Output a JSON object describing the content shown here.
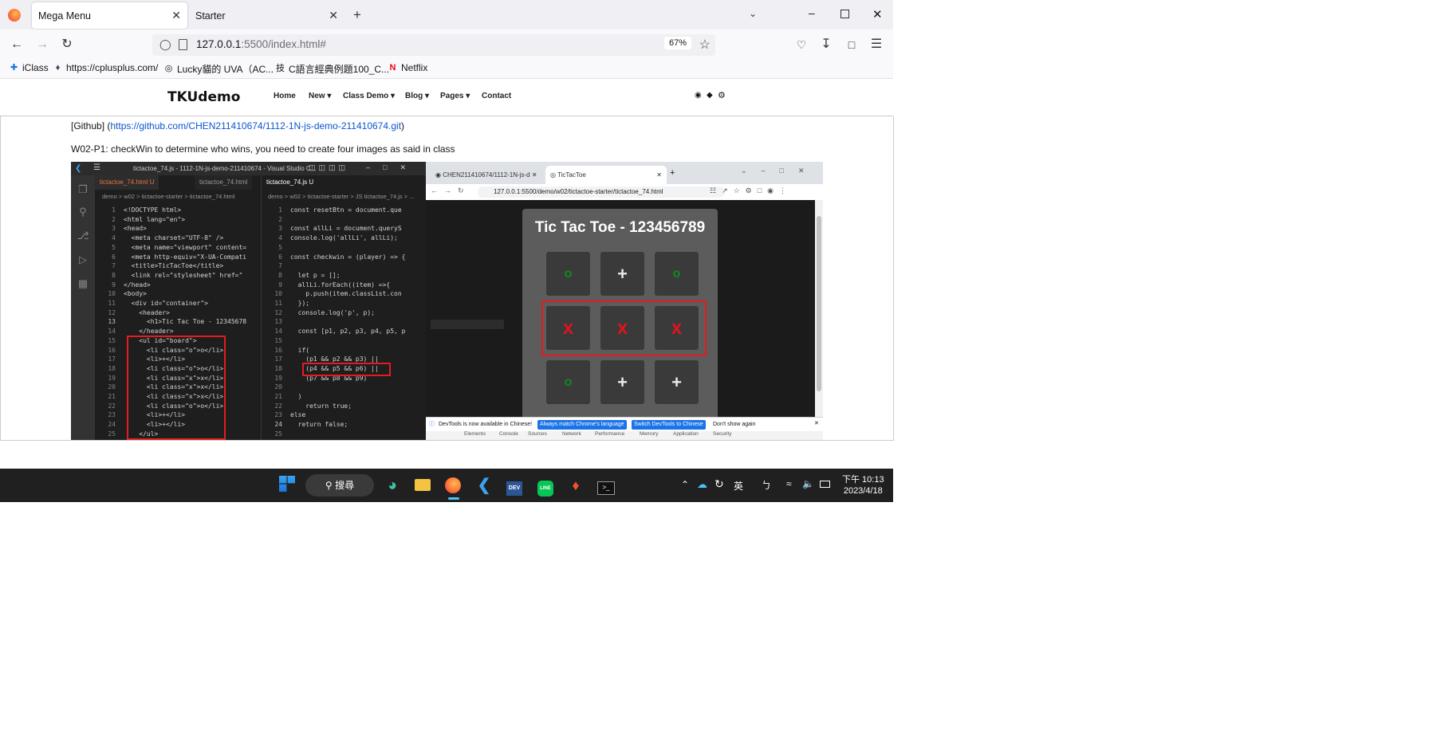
{
  "browser": {
    "tabs": [
      {
        "title": "Mega Menu",
        "active": true
      },
      {
        "title": "Starter",
        "active": false
      }
    ],
    "url_host": "127.0.0.1",
    "url_rest": ":5500/index.html#",
    "zoom": "67%",
    "bookmarks": [
      "iClass",
      "https://cplusplus.com/",
      "Lucky貓的 UVA（AC...",
      "C語言經典例題100_C...",
      "Netflix"
    ]
  },
  "site": {
    "brand": "TKUdemo",
    "menu": [
      "Home",
      "New",
      "Class Demo",
      "Blog",
      "Pages",
      "Contact"
    ],
    "github_prefix": "[Github] (",
    "github_link": "https://github.com/CHEN211410674/1112-1N-js-demo-211410674.git",
    "github_suffix": ")",
    "description": "W02-P1: checkWin to determine who wins, you need to create four images as said in class"
  },
  "screenshot": {
    "vscode_title": "tictactoe_74.js - 1112-1N-js-demo-211410674 - Visual Studio C...",
    "left_tab": "tictactoe_74.html U",
    "left_tab2": "tictactoe_74.html",
    "right_tab": "tictactoe_74.js U",
    "left_crumb": "demo > w02 > tictactoe-starter > tictactoe_74.html",
    "right_crumb": "demo > w02 > tictactoe-starter > JS tictactoe_74.js > ...",
    "html_lines": [
      "<!DOCTYPE html>",
      "<html lang=\"en\">",
      "<head>",
      "  <meta charset=\"UTF-8\" />",
      "  <meta name=\"viewport\" content=",
      "  <meta http-equiv=\"X-UA-Compati",
      "  <title>TicTacToe</title>",
      "  <link rel=\"stylesheet\" href=\"",
      "</head>",
      "<body>",
      "  <div id=\"container\">",
      "    <header>",
      "      <h1>Tic Tac Toe - 12345678",
      "    </header>",
      "    <ul id=\"board\">",
      "      <li class=\"o\">o</li>",
      "      <li>+</li>",
      "      <li class=\"o\">o</li>",
      "      <li class=\"x\">x</li>",
      "      <li class=\"x\">x</li>",
      "      <li class=\"x\">x</li>",
      "      <li class=\"o\">o</li>",
      "      <li>+</li>",
      "      <li>+</li>",
      "    </ul>"
    ],
    "js_lines": [
      "const resetBtn = document.que",
      "",
      "const allLi = document.queryS",
      "console.log('allLi', allLi);",
      "",
      "const checkwin = (player) => {",
      "",
      "  let p = [];",
      "  allLi.forEach((item) =>{",
      "    p.push(item.classList.con",
      "  });",
      "  console.log('p', p);",
      "",
      "  const [p1, p2, p3, p4, p5, p",
      "",
      "  if(",
      "    (p1 && p2 && p3) ||",
      "    (p4 && p5 && p6) ||",
      "    (p7 && p8 && p9)",
      "",
      "  )",
      "    return true;",
      "else",
      "  return false;",
      ""
    ],
    "chrome_tabs": [
      "CHEN211410674/1112-1N-js-d",
      "TicTacToe"
    ],
    "chrome_url": "127.0.0.1:5500/demo/w02/tictactoe-starter/tictactoe_74.html",
    "game_title": "Tic Tac Toe - 123456789",
    "cells": [
      "o",
      "+",
      "o",
      "x",
      "x",
      "x",
      "o",
      "+",
      "+"
    ],
    "devtools_msg": "DevTools is now available in Chinese!",
    "devtools_btn1": "Always match Chrome's language",
    "devtools_btn2": "Switch DevTools to Chinese",
    "devtools_btn3": "Don't show again",
    "devtools_tabs": [
      "Elements",
      "Console",
      "Sources",
      "Network",
      "Performance",
      "Memory",
      "Application",
      "Security"
    ]
  },
  "taskbar": {
    "search": "搜尋",
    "ime": "英",
    "time": "下午 10:13",
    "date": "2023/4/18"
  }
}
